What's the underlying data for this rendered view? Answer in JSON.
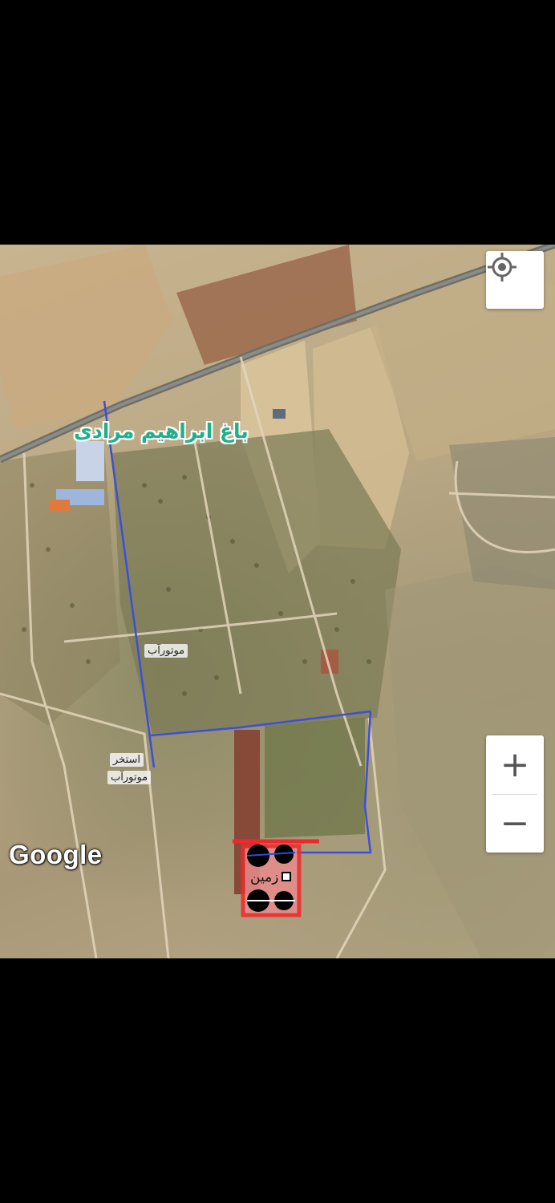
{
  "map": {
    "labels": {
      "garden": "باغ ابراهیم مرادی",
      "motor_water_1": "موتورآب",
      "pool_line1": "استخر",
      "pool_line2": "موتورآب",
      "land": "زمین"
    },
    "attribution": "Google",
    "controls": {
      "zoom_in": "+",
      "zoom_out": "−"
    },
    "icons": {
      "locate": "crosshair-location-icon"
    },
    "colors": {
      "boundary_line": "#3a4fd8",
      "land_box": "#f0282d",
      "land_fill": "#e88b8b",
      "garden_label": "#1fb08a"
    }
  }
}
